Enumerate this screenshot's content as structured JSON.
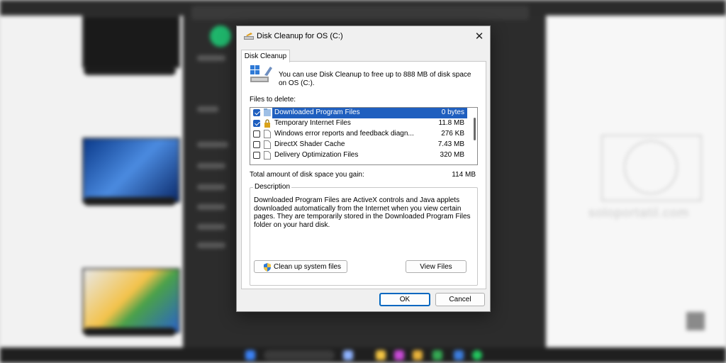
{
  "dialog": {
    "title": "Disk Cleanup for OS (C:)",
    "tab": "Disk Cleanup",
    "header_text": "You can use Disk Cleanup to free up to 888 MB of disk space on OS (C:).",
    "files_to_delete_label": "Files to delete:",
    "files": [
      {
        "name": "Downloaded Program Files",
        "size": "0 bytes",
        "checked": true,
        "selected": true,
        "icon": "folder-icon"
      },
      {
        "name": "Temporary Internet Files",
        "size": "11.8 MB",
        "checked": true,
        "selected": false,
        "icon": "lock-icon"
      },
      {
        "name": "Windows error reports and feedback diagn...",
        "size": "276 KB",
        "checked": false,
        "selected": false,
        "icon": "file-icon"
      },
      {
        "name": "DirectX Shader Cache",
        "size": "7.43 MB",
        "checked": false,
        "selected": false,
        "icon": "file-icon"
      },
      {
        "name": "Delivery Optimization Files",
        "size": "320 MB",
        "checked": false,
        "selected": false,
        "icon": "file-icon"
      }
    ],
    "total_label": "Total amount of disk space you gain:",
    "total_value": "114 MB",
    "description_label": "Description",
    "description_text": "Downloaded Program Files are ActiveX controls and Java applets downloaded automatically from the Internet when you view certain pages. They are temporarily stored in the Downloaded Program Files folder on your hard disk.",
    "cleanup_system_button": "Clean up system files",
    "view_files_button": "View Files",
    "ok_button": "OK",
    "cancel_button": "Cancel",
    "close_icon": "close-icon",
    "accent_color": "#1f5fbf"
  },
  "background": {
    "watermark": "soloportatil.com"
  }
}
